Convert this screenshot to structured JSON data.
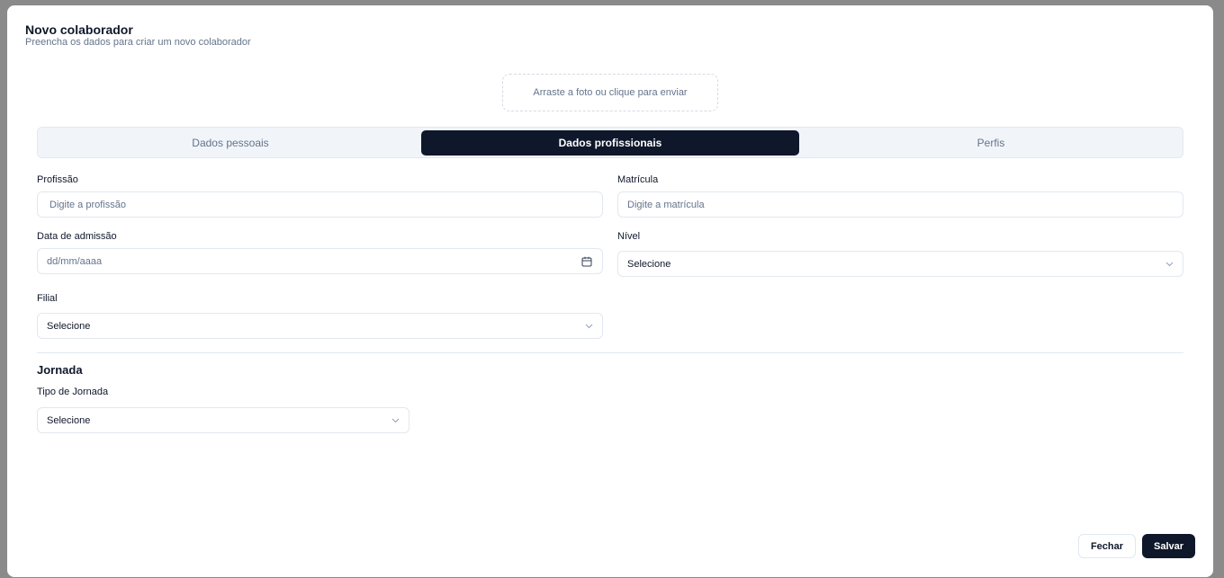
{
  "dialog": {
    "title": "Novo colaborador",
    "subtitle": "Preencha os dados para criar um novo colaborador"
  },
  "photo_upload": {
    "label": "Arraste a foto ou clique para enviar"
  },
  "tabs": [
    {
      "label": "Dados pessoais",
      "active": false
    },
    {
      "label": "Dados profissionais",
      "active": true
    },
    {
      "label": "Perfis",
      "active": false
    }
  ],
  "form": {
    "profissao": {
      "label": "Profissão",
      "placeholder": "Digite a profissão"
    },
    "matricula": {
      "label": "Matrícula",
      "placeholder": "Digite a matrícula"
    },
    "data_admissao": {
      "label": "Data de admissão",
      "placeholder": "dd/mm/aaaa"
    },
    "nivel": {
      "label": "Nível",
      "value": "Selecione"
    },
    "filial": {
      "label": "Filial",
      "value": "Selecione"
    }
  },
  "jornada": {
    "title": "Jornada",
    "tipo": {
      "label": "Tipo de Jornada",
      "value": "Selecione"
    }
  },
  "footer": {
    "close_label": "Fechar",
    "save_label": "Salvar"
  },
  "colors": {
    "primary": "#0f172a",
    "muted": "#64748b",
    "border": "#e2e8f0",
    "tabs_bg": "#f1f5f9",
    "overlay": "#8a8a8a"
  }
}
